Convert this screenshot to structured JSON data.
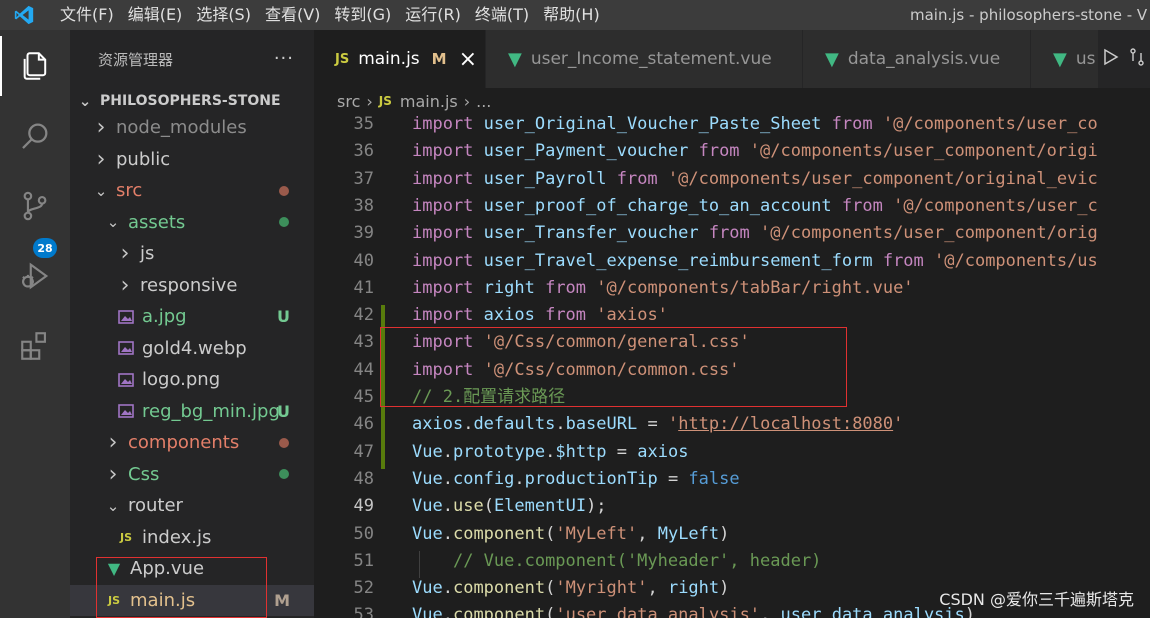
{
  "menu": {
    "items": [
      "文件(F)",
      "编辑(E)",
      "选择(S)",
      "查看(V)",
      "转到(G)",
      "运行(R)",
      "终端(T)",
      "帮助(H)"
    ],
    "window_title": "main.js - philosophers-stone - V"
  },
  "activity": {
    "scm_badge": "28"
  },
  "sidebar": {
    "title": "资源管理器",
    "more": "···",
    "project": "PHILOSOPHERS-STONE",
    "tree": [
      {
        "label": "node_modules",
        "kind": "folder",
        "open": false,
        "level": 0,
        "color": "#8c8c8c"
      },
      {
        "label": "public",
        "kind": "folder",
        "open": false,
        "level": 0,
        "color": "#cccccc"
      },
      {
        "label": "src",
        "kind": "folder",
        "open": true,
        "level": 0,
        "color": "#e37f69",
        "dot": "#9a5a4b"
      },
      {
        "label": "assets",
        "kind": "folder",
        "open": true,
        "level": 1,
        "color": "#73c991",
        "dot": "#3d8f5b"
      },
      {
        "label": "js",
        "kind": "folder",
        "open": false,
        "level": 2,
        "color": "#cccccc"
      },
      {
        "label": "responsive",
        "kind": "folder",
        "open": false,
        "level": 2,
        "color": "#cccccc"
      },
      {
        "label": "a.jpg",
        "kind": "image",
        "level": 2,
        "color": "#73c991",
        "git": "U"
      },
      {
        "label": "gold4.webp",
        "kind": "image",
        "level": 2,
        "color": "#cccccc"
      },
      {
        "label": "logo.png",
        "kind": "image",
        "level": 2,
        "color": "#cccccc"
      },
      {
        "label": "reg_bg_min.jpg",
        "kind": "image",
        "level": 2,
        "color": "#73c991",
        "git": "U"
      },
      {
        "label": "components",
        "kind": "folder",
        "open": false,
        "level": 1,
        "color": "#e37f69",
        "dot": "#9a5a4b"
      },
      {
        "label": "Css",
        "kind": "folder",
        "open": false,
        "level": 1,
        "color": "#73c991",
        "dot": "#3d8f5b"
      },
      {
        "label": "router",
        "kind": "folder",
        "open": true,
        "level": 1,
        "color": "#cccccc"
      },
      {
        "label": "index.js",
        "kind": "js",
        "level": 2,
        "color": "#cccccc"
      },
      {
        "label": "App.vue",
        "kind": "vue",
        "level": 1,
        "color": "#cccccc"
      },
      {
        "label": "main.js",
        "kind": "js",
        "level": 1,
        "color": "#e2c08d",
        "git": "M",
        "selected": true
      }
    ]
  },
  "tabs": [
    {
      "label": "main.js",
      "kind": "js",
      "status": "M",
      "close": "×",
      "active": true
    },
    {
      "label": "user_Income_statement.vue",
      "kind": "vue",
      "active": false
    },
    {
      "label": "data_analysis.vue",
      "kind": "vue",
      "active": false
    },
    {
      "label": "us",
      "kind": "vue",
      "active": false
    }
  ],
  "breadcrumb": [
    "src",
    "main.js",
    "..."
  ],
  "editor": {
    "current_line": 49,
    "lines": [
      {
        "n": 35,
        "tokens": [
          [
            "kw",
            "import "
          ],
          [
            "id",
            "user_Original_Voucher_Paste_Sheet "
          ],
          [
            "kw",
            "from "
          ],
          [
            "str",
            "'@/components/user_co"
          ]
        ]
      },
      {
        "n": 36,
        "tokens": [
          [
            "kw",
            "import "
          ],
          [
            "id",
            "user_Payment_voucher "
          ],
          [
            "kw",
            "from "
          ],
          [
            "str",
            "'@/components/user_component/origi"
          ]
        ]
      },
      {
        "n": 37,
        "tokens": [
          [
            "kw",
            "import "
          ],
          [
            "id",
            "user_Payroll "
          ],
          [
            "kw",
            "from "
          ],
          [
            "str",
            "'@/components/user_component/original_evic"
          ]
        ]
      },
      {
        "n": 38,
        "tokens": [
          [
            "kw",
            "import "
          ],
          [
            "id",
            "user_proof_of_charge_to_an_account "
          ],
          [
            "kw",
            "from "
          ],
          [
            "str",
            "'@/components/user_c"
          ]
        ]
      },
      {
        "n": 39,
        "tokens": [
          [
            "kw",
            "import "
          ],
          [
            "id",
            "user_Transfer_voucher "
          ],
          [
            "kw",
            "from "
          ],
          [
            "str",
            "'@/components/user_component/orig"
          ]
        ]
      },
      {
        "n": 40,
        "tokens": [
          [
            "kw",
            "import "
          ],
          [
            "id",
            "user_Travel_expense_reimbursement_form "
          ],
          [
            "kw",
            "from "
          ],
          [
            "str",
            "'@/components/us"
          ]
        ]
      },
      {
        "n": 41,
        "tokens": [
          [
            "kw",
            "import "
          ],
          [
            "id",
            "right "
          ],
          [
            "kw",
            "from "
          ],
          [
            "str",
            "'@/components/tabBar/right.vue'"
          ]
        ]
      },
      {
        "n": 42,
        "tokens": [
          [
            "kw",
            "import "
          ],
          [
            "id",
            "axios "
          ],
          [
            "kw",
            "from "
          ],
          [
            "str",
            "'axios'"
          ]
        ],
        "git": true
      },
      {
        "n": 43,
        "tokens": [
          [
            "kw",
            "import "
          ],
          [
            "str",
            "'@/Css/common/general.css'"
          ]
        ],
        "git": true
      },
      {
        "n": 44,
        "tokens": [
          [
            "kw",
            "import "
          ],
          [
            "str",
            "'@/Css/common/common.css'"
          ]
        ],
        "git": true
      },
      {
        "n": 45,
        "tokens": [
          [
            "cm",
            "// 2.配置请求路径"
          ]
        ],
        "git": true
      },
      {
        "n": 46,
        "tokens": [
          [
            "id",
            "axios"
          ],
          [
            "plain",
            "."
          ],
          [
            "id",
            "defaults"
          ],
          [
            "plain",
            "."
          ],
          [
            "id",
            "baseURL"
          ],
          [
            "plain",
            " = "
          ],
          [
            "str",
            "'"
          ],
          [
            "strlink",
            "http://localhost:8080"
          ],
          [
            "str",
            "'"
          ]
        ],
        "git": true
      },
      {
        "n": 47,
        "tokens": [
          [
            "id",
            "Vue"
          ],
          [
            "plain",
            "."
          ],
          [
            "id",
            "prototype"
          ],
          [
            "plain",
            "."
          ],
          [
            "id",
            "$http"
          ],
          [
            "plain",
            " = "
          ],
          [
            "id",
            "axios"
          ]
        ],
        "git": true
      },
      {
        "n": 48,
        "tokens": [
          [
            "id",
            "Vue"
          ],
          [
            "plain",
            "."
          ],
          [
            "id",
            "config"
          ],
          [
            "plain",
            "."
          ],
          [
            "id",
            "productionTip"
          ],
          [
            "plain",
            " = "
          ],
          [
            "kw2",
            "false"
          ]
        ]
      },
      {
        "n": 49,
        "tokens": [
          [
            "id",
            "Vue"
          ],
          [
            "plain",
            "."
          ],
          [
            "fn",
            "use"
          ],
          [
            "plain",
            "("
          ],
          [
            "id",
            "ElementUI"
          ],
          [
            "plain",
            ");"
          ]
        ]
      },
      {
        "n": 50,
        "tokens": [
          [
            "id",
            "Vue"
          ],
          [
            "plain",
            "."
          ],
          [
            "fn",
            "component"
          ],
          [
            "plain",
            "("
          ],
          [
            "str",
            "'MyLeft'"
          ],
          [
            "plain",
            ", "
          ],
          [
            "id",
            "MyLeft"
          ],
          [
            "plain",
            ")"
          ]
        ]
      },
      {
        "n": 51,
        "tokens": [
          [
            "plain",
            "    "
          ],
          [
            "cm",
            "// Vue.component('Myheader', header)"
          ]
        ],
        "guide": true
      },
      {
        "n": 52,
        "tokens": [
          [
            "id",
            "Vue"
          ],
          [
            "plain",
            "."
          ],
          [
            "fn",
            "component"
          ],
          [
            "plain",
            "("
          ],
          [
            "str",
            "'Myright'"
          ],
          [
            "plain",
            ", "
          ],
          [
            "id",
            "right"
          ],
          [
            "plain",
            ")"
          ]
        ]
      },
      {
        "n": 53,
        "tokens": [
          [
            "id",
            "Vue"
          ],
          [
            "plain",
            "."
          ],
          [
            "fn",
            "component"
          ],
          [
            "plain",
            "("
          ],
          [
            "str",
            "'user_data_analysis'"
          ],
          [
            "plain",
            ", "
          ],
          [
            "id",
            "user_data_analysis"
          ],
          [
            "plain",
            ")"
          ]
        ]
      }
    ]
  },
  "watermark": "CSDN @爱你三千遍斯塔克"
}
